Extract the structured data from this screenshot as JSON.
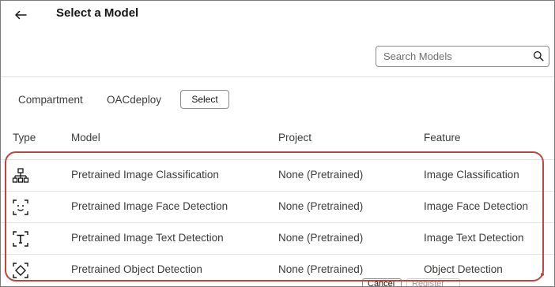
{
  "header": {
    "back_icon": "arrow-left-icon",
    "title": "Select a Model"
  },
  "search": {
    "placeholder": "Search Models",
    "value": "",
    "icon": "search-icon"
  },
  "compartment": {
    "label": "Compartment",
    "value": "OACdeploy",
    "select_label": "Select"
  },
  "table": {
    "columns": [
      "Type",
      "Model",
      "Project",
      "Feature"
    ],
    "rows": [
      {
        "icon": "image-classification-icon",
        "model": "Pretrained Image Classification",
        "project": "None (Pretrained)",
        "feature": "Image Classification"
      },
      {
        "icon": "face-detection-icon",
        "model": "Pretrained Image Face Detection",
        "project": "None (Pretrained)",
        "feature": "Image Face Detection"
      },
      {
        "icon": "text-detection-icon",
        "model": "Pretrained Image Text Detection",
        "project": "None (Pretrained)",
        "feature": "Image Text Detection"
      },
      {
        "icon": "object-detection-icon",
        "model": "Pretrained Object Detection",
        "project": "None (Pretrained)",
        "feature": "Object Detection"
      }
    ]
  },
  "footer": {
    "cancel_label": "Cancel",
    "register_label": "Register"
  },
  "colors": {
    "highlight": "#c0453a",
    "text": "#3d3b38",
    "border": "#dcdbd9"
  }
}
